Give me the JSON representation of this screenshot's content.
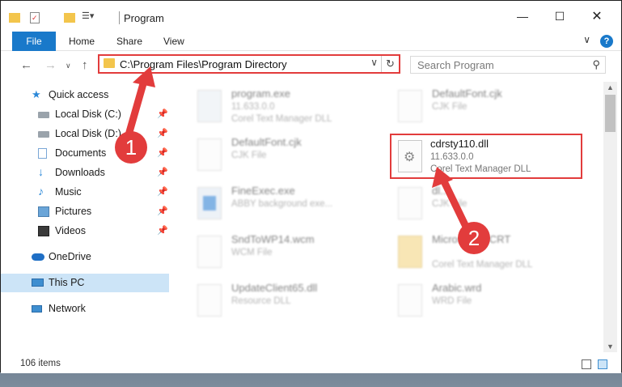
{
  "window": {
    "title": "Program"
  },
  "titlebar": {
    "minimize_icon": "minimize-icon",
    "maximize_icon": "maximize-icon",
    "close_icon": "close-icon"
  },
  "ribbon": {
    "tabs": [
      "File",
      "Home",
      "Share",
      "View"
    ],
    "help_label": "?"
  },
  "address": {
    "path": "C:\\Program Files\\Program Directory",
    "search_placeholder": "Search Program"
  },
  "sidebar": {
    "items": [
      {
        "label": "Quick access",
        "icon": "star-icon",
        "pinned": false
      },
      {
        "label": "Local Disk (C:)",
        "icon": "drive-icon",
        "pinned": true
      },
      {
        "label": "Local Disk (D:)",
        "icon": "drive-icon",
        "pinned": true
      },
      {
        "label": "Documents",
        "icon": "documents-icon",
        "pinned": true
      },
      {
        "label": "Downloads",
        "icon": "download-icon",
        "pinned": true
      },
      {
        "label": "Music",
        "icon": "music-icon",
        "pinned": true
      },
      {
        "label": "Pictures",
        "icon": "pictures-icon",
        "pinned": true
      },
      {
        "label": "Videos",
        "icon": "videos-icon",
        "pinned": true
      },
      {
        "label": "OneDrive",
        "icon": "cloud-icon",
        "pinned": false
      },
      {
        "label": "This PC",
        "icon": "computer-icon",
        "pinned": false,
        "selected": true
      },
      {
        "label": "Network",
        "icon": "network-icon",
        "pinned": false
      }
    ]
  },
  "files": [
    {
      "name": "program.exe",
      "line2": "11.633.0.0",
      "line3": "Corel Text Manager DLL",
      "icon": "exe-icon"
    },
    {
      "name": "DefaultFont.cjk",
      "line2": "CJK File",
      "line3": "",
      "icon": "document-icon"
    },
    {
      "name": "DefaultFont.cjk",
      "line2": "CJK File",
      "line3": "",
      "icon": "document-icon"
    },
    {
      "name": "cdrsty110.dll",
      "line2": "11.633.0.0",
      "line3": "Corel Text Manager DLL",
      "icon": "gear-file-icon"
    },
    {
      "name": "FineExec.exe",
      "line2": "ABBY background exe...",
      "line3": "",
      "icon": "app-icon"
    },
    {
      "name": "dl...",
      "line2": "CJK File",
      "line3": "",
      "icon": "document-icon"
    },
    {
      "name": "SndToWP14.wcm",
      "line2": "WCM File",
      "line3": "",
      "icon": "document-icon"
    },
    {
      "name": "Micros... 90.CRT",
      "line2": "",
      "line3": "Corel Text Manager DLL",
      "icon": "folder-zip-icon"
    },
    {
      "name": "UpdateClient65.dll",
      "line2": "Resource DLL",
      "line3": "",
      "icon": "gear-file-icon"
    },
    {
      "name": "Arabic.wrd",
      "line2": "WRD File",
      "line3": "",
      "icon": "document-icon"
    }
  ],
  "status": {
    "item_count": "106 items"
  },
  "annotations": {
    "step1": "1",
    "step2": "2"
  },
  "colors": {
    "accent": "#1979ca",
    "annotation": "#e23c3c",
    "selected": "#cce4f7"
  }
}
